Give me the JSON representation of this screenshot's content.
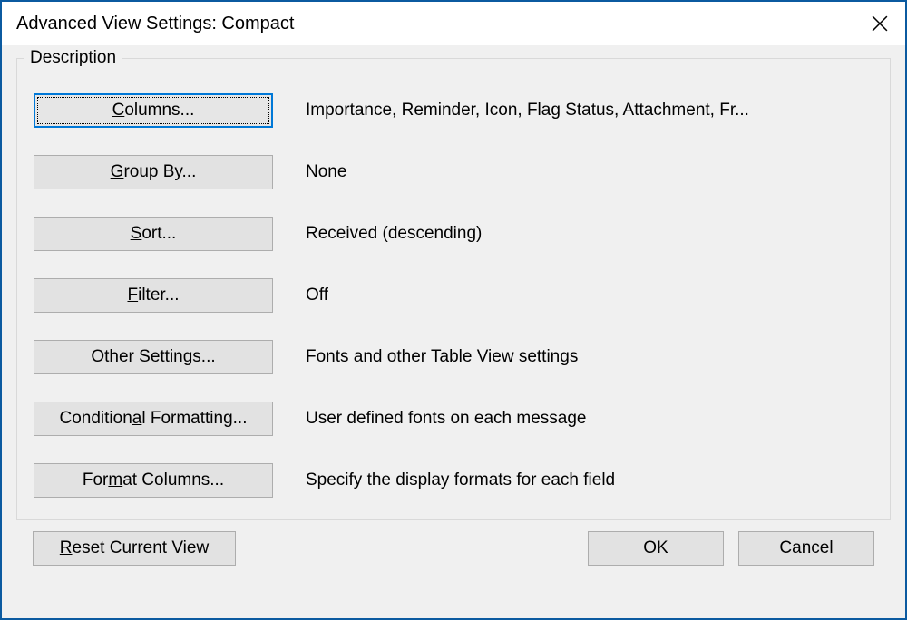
{
  "titlebar": {
    "title": "Advanced View Settings: Compact"
  },
  "groupbox_label": "Description",
  "rows": [
    {
      "button_prefix": "",
      "accel": "C",
      "button_suffix": "olumns...",
      "desc": "Importance, Reminder, Icon, Flag Status, Attachment, Fr..."
    },
    {
      "button_prefix": "",
      "accel": "G",
      "button_suffix": "roup By...",
      "desc": "None"
    },
    {
      "button_prefix": "",
      "accel": "S",
      "button_suffix": "ort...",
      "desc": "Received (descending)"
    },
    {
      "button_prefix": "",
      "accel": "F",
      "button_suffix": "ilter...",
      "desc": "Off"
    },
    {
      "button_prefix": "",
      "accel": "O",
      "button_suffix": "ther Settings...",
      "desc": "Fonts and other Table View settings"
    },
    {
      "button_prefix": "Condition",
      "accel": "a",
      "button_suffix": "l Formatting...",
      "desc": "User defined fonts on each message"
    },
    {
      "button_prefix": "For",
      "accel": "m",
      "button_suffix": "at Columns...",
      "desc": "Specify the display formats for each field"
    }
  ],
  "footer": {
    "reset_prefix": "",
    "reset_accel": "R",
    "reset_suffix": "eset Current View",
    "ok_label": "OK",
    "cancel_label": "Cancel"
  }
}
